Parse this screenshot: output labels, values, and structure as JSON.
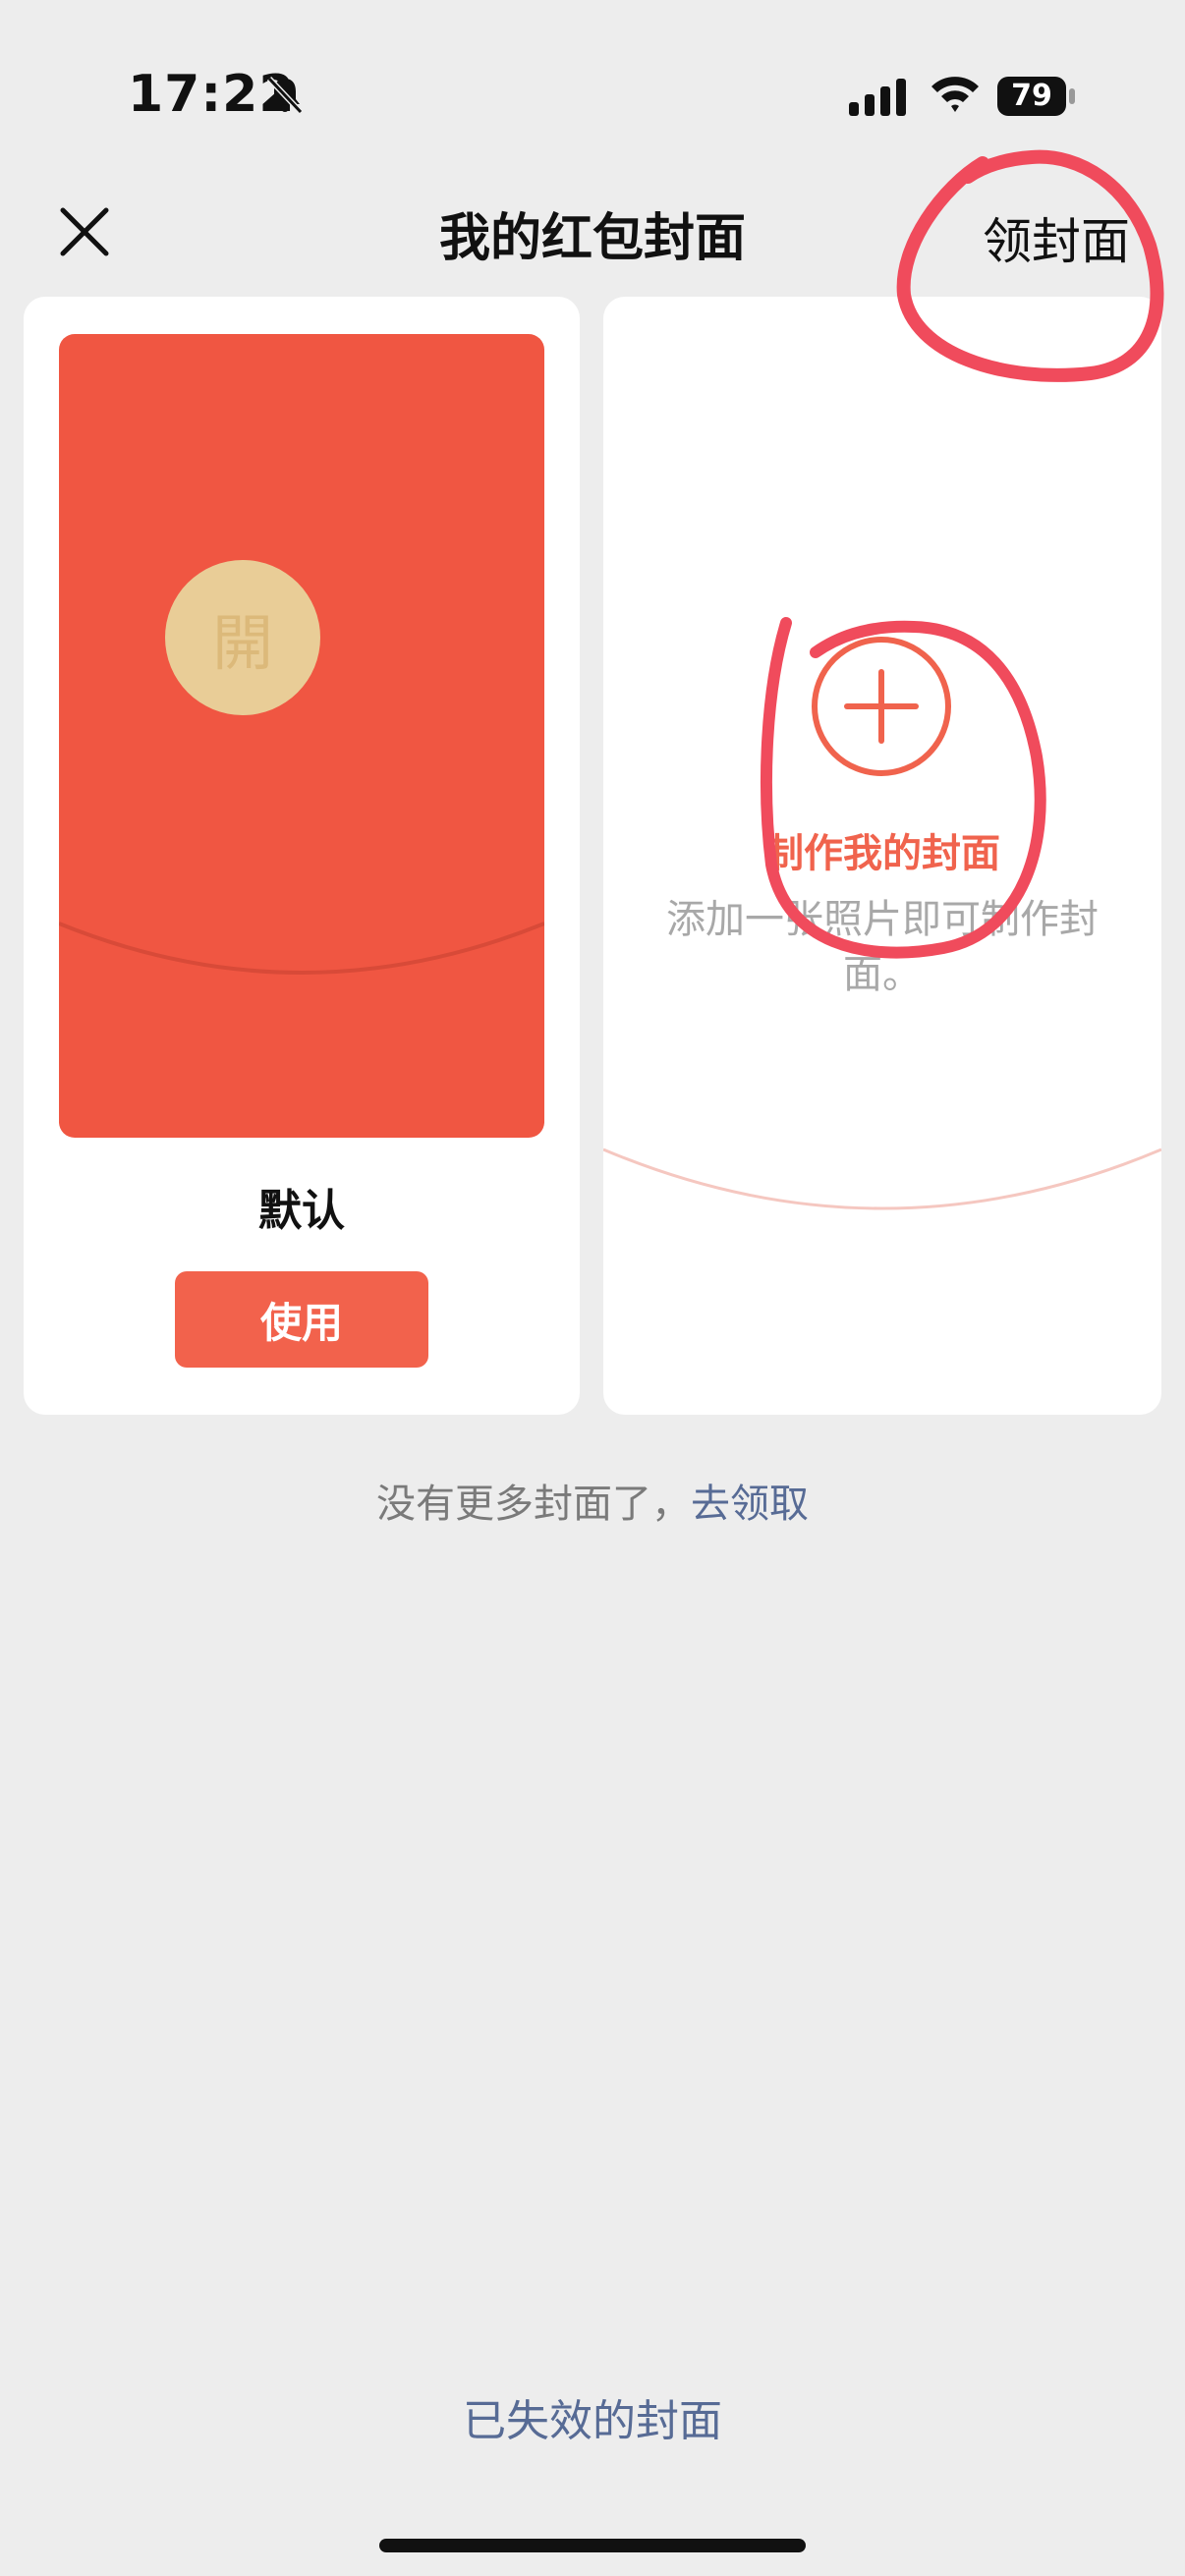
{
  "status_bar": {
    "time": "17:22",
    "battery": "79",
    "icons": [
      "bell-muted-icon",
      "cellular-signal-icon",
      "wifi-icon",
      "battery-icon"
    ]
  },
  "nav": {
    "title": "我的红包封面",
    "get_cover": "领封面",
    "close_icon": "close-icon"
  },
  "default_cover": {
    "seal_char": "開",
    "label": "默认",
    "use_button": "使用",
    "colors": {
      "envelope": "#f05642",
      "seal": "#e9cd97",
      "button": "#f2624c"
    }
  },
  "make_cover": {
    "title": "制作我的封面",
    "description": "添加一张照片即可制作封面。",
    "icon": "plus-circle-icon",
    "accent": "#f0634d"
  },
  "footer": {
    "no_more_text": "没有更多封面了，",
    "go_claim": "去领取",
    "expired_link": "已失效的封面",
    "link_color": "#576b95"
  }
}
